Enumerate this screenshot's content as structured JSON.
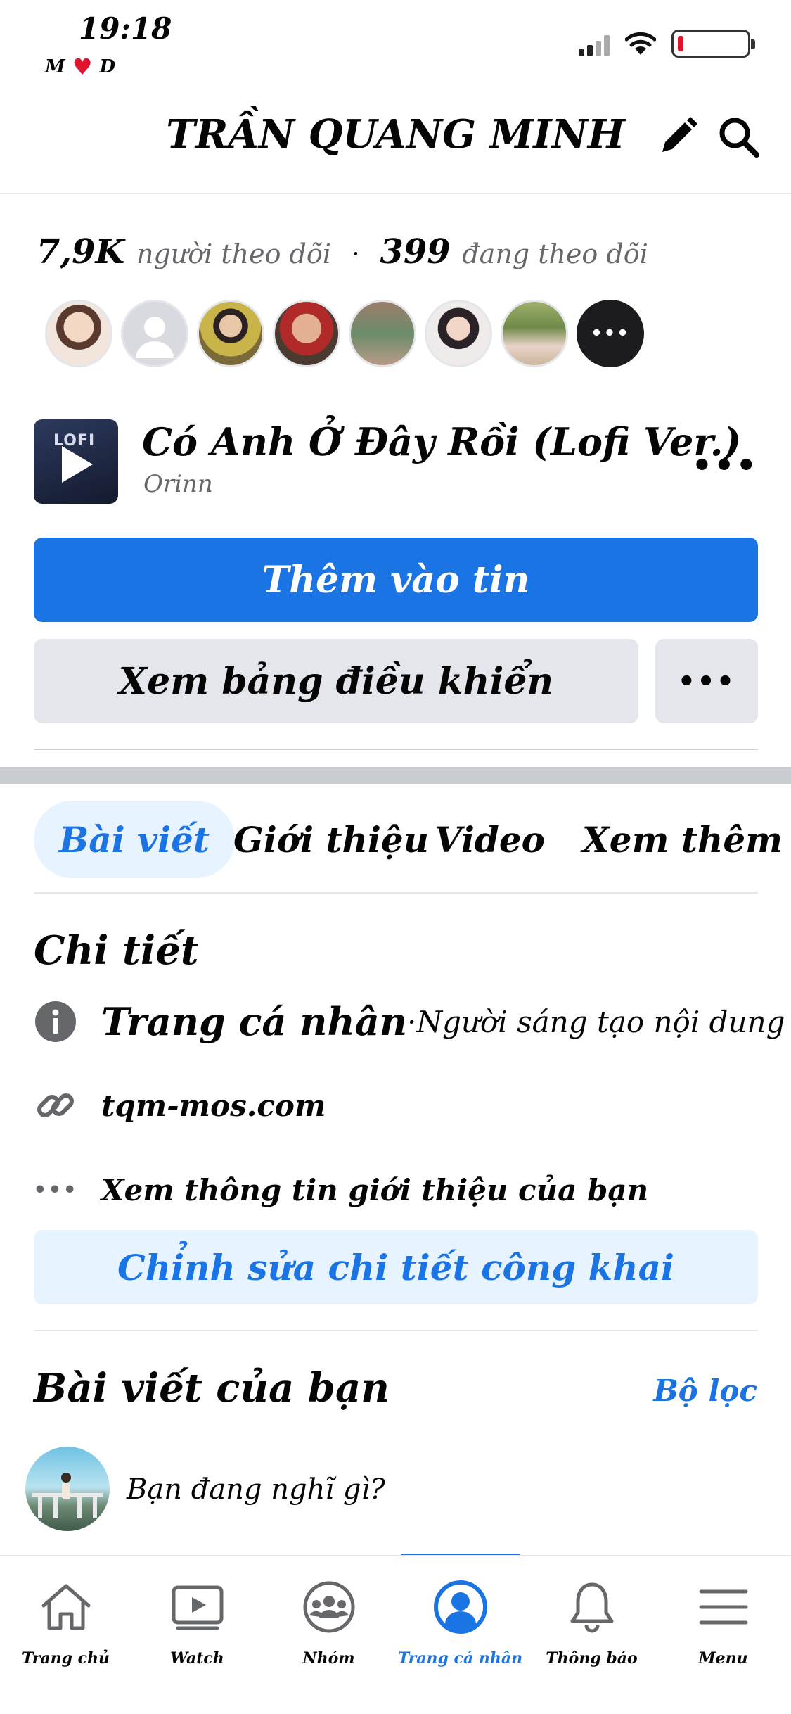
{
  "status_bar": {
    "time": "19:18",
    "carrier_left": "M",
    "carrier_right": "D"
  },
  "header": {
    "title": "TRẦN QUANG MINH",
    "edit_icon": "pencil-icon",
    "search_icon": "search-icon"
  },
  "stats": {
    "followers_count": "7,9K",
    "followers_label": "người theo dõi",
    "separator": "·",
    "following_count": "399",
    "following_label": "đang theo dõi"
  },
  "follower_avatars_count": 7,
  "music": {
    "cover_label": "LOFI",
    "title": "Có Anh Ở Đây Rồi (Lofi Ver.)",
    "artist": "Orinn",
    "more": "•••"
  },
  "buttons": {
    "add_story": "Thêm vào tin",
    "dashboard": "Xem bảng điều khiển",
    "more": "•••"
  },
  "tabs": [
    {
      "label": "Bài viết",
      "active": true
    },
    {
      "label": "Giới thiệu",
      "active": false
    },
    {
      "label": "Video",
      "active": false
    },
    {
      "label": "Xem thêm",
      "active": false
    }
  ],
  "details": {
    "title": "Chi tiết",
    "profile_type": "Trang cá nhân",
    "profile_sep": " · ",
    "profile_category": "Người sáng tạo nội dung số",
    "website": "tqm-mos.com",
    "more_info": "Xem thông tin giới thiệu của bạn",
    "edit_button": "Chỉnh sửa chi tiết công khai"
  },
  "posts": {
    "title": "Bài viết của bạn",
    "filter": "Bộ lọc",
    "composer_placeholder": "Bạn đang nghĩ gì?"
  },
  "bottom_nav": [
    {
      "label": "Trang chủ",
      "icon": "home-icon",
      "active": false
    },
    {
      "label": "Watch",
      "icon": "watch-icon",
      "active": false
    },
    {
      "label": "Nhóm",
      "icon": "groups-icon",
      "active": false
    },
    {
      "label": "Trang cá nhân",
      "icon": "profile-icon",
      "active": true
    },
    {
      "label": "Thông báo",
      "icon": "bell-icon",
      "active": false
    },
    {
      "label": "Menu",
      "icon": "menu-icon",
      "active": false
    }
  ],
  "colors": {
    "accent": "#1b74e4",
    "accent_light": "#e7f3ff",
    "button_gray": "#e4e6eb",
    "muted_text": "#65676b",
    "battery_low": "#e0142c"
  },
  "battery_level": 0.08
}
